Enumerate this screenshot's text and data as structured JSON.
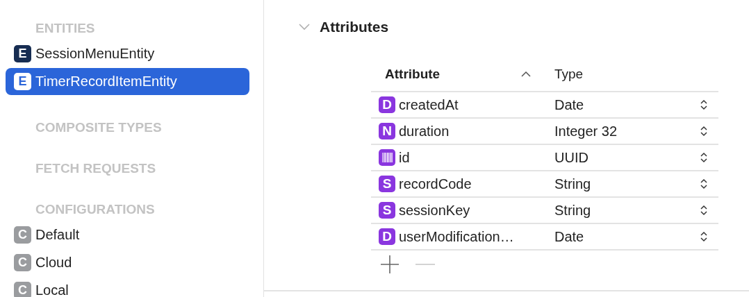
{
  "sidebar": {
    "sections": [
      {
        "title": "ENTITIES",
        "items": [
          {
            "label": "SessionMenuEntity",
            "kind": "entity",
            "badge": "E",
            "selected": false
          },
          {
            "label": "TimerRecordItemEntity",
            "kind": "entity",
            "badge": "E",
            "selected": true
          }
        ]
      },
      {
        "title": "COMPOSITE TYPES"
      },
      {
        "title": "FETCH REQUESTS"
      },
      {
        "title": "CONFIGURATIONS",
        "items": [
          {
            "label": "Default",
            "kind": "configuration",
            "badge": "C",
            "selected": false
          },
          {
            "label": "Cloud",
            "kind": "configuration",
            "badge": "C",
            "selected": false
          },
          {
            "label": "Local",
            "kind": "configuration",
            "badge": "C",
            "selected": false
          }
        ]
      }
    ]
  },
  "attributes": {
    "title": "Attributes",
    "expanded": true,
    "table": {
      "columns": [
        {
          "label": "Attribute",
          "sorted": true
        },
        {
          "label": "Type"
        }
      ],
      "rows": [
        {
          "kind": "letter",
          "badge": "D",
          "name": "createdAt",
          "type": "Date"
        },
        {
          "kind": "letter",
          "badge": "N",
          "name": "duration",
          "type": "Integer 32"
        },
        {
          "kind": "barcode",
          "name": "id",
          "type": "UUID"
        },
        {
          "kind": "letter",
          "badge": "S",
          "name": "recordCode",
          "type": "String"
        },
        {
          "kind": "letter",
          "badge": "S",
          "name": "sessionKey",
          "type": "String"
        },
        {
          "kind": "letter",
          "badge": "D",
          "name": "userModification…",
          "type": "Date"
        }
      ]
    },
    "remove_disabled": true
  }
}
